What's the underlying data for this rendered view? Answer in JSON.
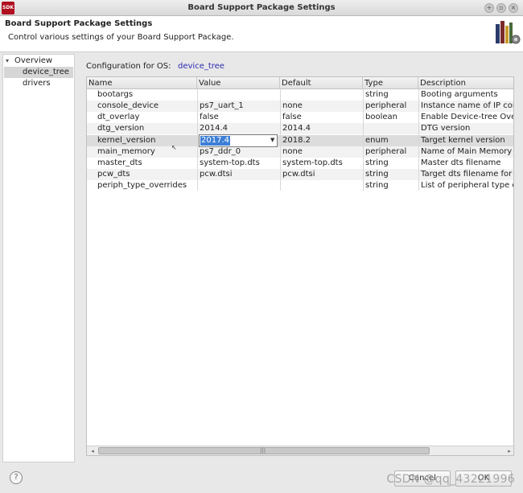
{
  "window": {
    "app_icon_text": "SDK",
    "title": "Board Support Package Settings",
    "controls": [
      "+",
      "▫",
      "×"
    ]
  },
  "header": {
    "title": "Board Support Package Settings",
    "description": "Control various settings of your Board Support Package."
  },
  "tree": {
    "root": "Overview",
    "items": [
      "device_tree",
      "drivers"
    ],
    "selected": "device_tree"
  },
  "config": {
    "label": "Configuration for OS:",
    "value": "device_tree"
  },
  "table": {
    "columns": [
      "Name",
      "Value",
      "Default",
      "Type",
      "Description"
    ],
    "rows": [
      {
        "name": "bootargs",
        "value": "",
        "default": "",
        "type": "string",
        "description": "Booting arguments"
      },
      {
        "name": "console_device",
        "value": "ps7_uart_1",
        "default": "none",
        "type": "peripheral",
        "description": "Instance name of IP core f"
      },
      {
        "name": "dt_overlay",
        "value": "false",
        "default": "false",
        "type": "boolean",
        "description": "Enable Device-tree Overla"
      },
      {
        "name": "dtg_version",
        "value": "2014.4",
        "default": "2014.4",
        "type": "",
        "description": "DTG version"
      },
      {
        "name": "kernel_version",
        "value": "2017.4",
        "default": "2018.2",
        "type": "enum",
        "description": "Target kernel version"
      },
      {
        "name": "main_memory",
        "value": "ps7_ddr_0",
        "default": "none",
        "type": "peripheral",
        "description": "Name of Main Memory use"
      },
      {
        "name": "master_dts",
        "value": "system-top.dts",
        "default": "system-top.dts",
        "type": "string",
        "description": "Master dts filename"
      },
      {
        "name": "pcw_dts",
        "value": "pcw.dtsi",
        "default": "pcw.dtsi",
        "type": "string",
        "description": "Target dts filename for PCV"
      },
      {
        "name": "periph_type_overrides",
        "value": "",
        "default": "",
        "type": "string",
        "description": "List of peripheral type ove"
      }
    ],
    "editing_row": 4,
    "editor_value": "2017.4"
  },
  "scrollbar": {
    "left_arrow": "◂",
    "right_arrow": "▸",
    "grip": "|||"
  },
  "footer": {
    "help": "?",
    "cancel_label": "Cancel",
    "ok_label": "OK",
    "watermark": "CSDN @qq_43221996"
  },
  "colors": {
    "accent": "#3d7fd6",
    "config_value": "#2b2bb0",
    "app_icon": "#b01020"
  }
}
